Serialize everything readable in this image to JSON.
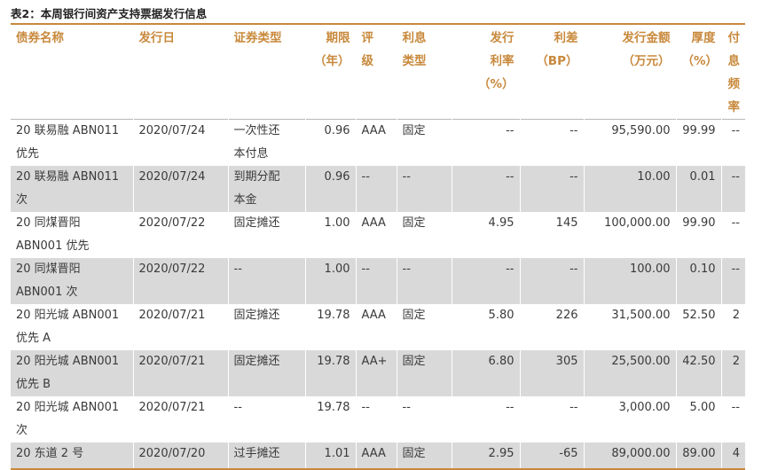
{
  "table_title": "表2：本周银行间资产支持票据发行信息",
  "columns": [
    {
      "line1": "债券名称",
      "line2": "",
      "line3": ""
    },
    {
      "line1": "发行日",
      "line2": "",
      "line3": ""
    },
    {
      "line1": "证券类型",
      "line2": "",
      "line3": ""
    },
    {
      "line1": "期限",
      "line2": "（年）",
      "line3": ""
    },
    {
      "line1": "评",
      "line2": "级",
      "line3": ""
    },
    {
      "line1": "利息",
      "line2": "类型",
      "line3": ""
    },
    {
      "line1": "发行",
      "line2": "利率",
      "line3": "（%）"
    },
    {
      "line1": "利差",
      "line2": "（BP）",
      "line3": ""
    },
    {
      "line1": "发行金额",
      "line2": "（万元）",
      "line3": ""
    },
    {
      "line1": "厚度",
      "line2": "（%）",
      "line3": ""
    },
    {
      "line1": "付息",
      "line2": "频率",
      "line3": ""
    }
  ],
  "rows": [
    {
      "name1": "20 联易融 ABN011",
      "name2": "优先",
      "date": "2020/07/24",
      "type1": "一次性还",
      "type2": "本付息",
      "term": "0.96",
      "rating": "AAA",
      "interest": "固定",
      "rate": "--",
      "spread": "--",
      "amount": "95,590.00",
      "thickness": "99.99",
      "freq": "--"
    },
    {
      "name1": "20 联易融 ABN011",
      "name2": "次",
      "date": "2020/07/24",
      "type1": "到期分配",
      "type2": "本金",
      "term": "0.96",
      "rating": "--",
      "interest": "--",
      "rate": "--",
      "spread": "--",
      "amount": "10.00",
      "thickness": "0.01",
      "freq": "--"
    },
    {
      "name1": "20 同煤晋阳",
      "name2": "ABN001 优先",
      "date": "2020/07/22",
      "type1": "固定摊还",
      "type2": "",
      "term": "1.00",
      "rating": "AAA",
      "interest": "固定",
      "rate": "4.95",
      "spread": "145",
      "amount": "100,000.00",
      "thickness": "99.90",
      "freq": "--"
    },
    {
      "name1": "20 同煤晋阳",
      "name2": "ABN001 次",
      "date": "2020/07/22",
      "type1": "--",
      "type2": "",
      "term": "1.00",
      "rating": "--",
      "interest": "--",
      "rate": "--",
      "spread": "--",
      "amount": "100.00",
      "thickness": "0.10",
      "freq": "--"
    },
    {
      "name1": "20 阳光城 ABN001",
      "name2": "优先 A",
      "date": "2020/07/21",
      "type1": "固定摊还",
      "type2": "",
      "term": "19.78",
      "rating": "AAA",
      "interest": "固定",
      "rate": "5.80",
      "spread": "226",
      "amount": "31,500.00",
      "thickness": "52.50",
      "freq": "2"
    },
    {
      "name1": "20 阳光城 ABN001",
      "name2": "优先 B",
      "date": "2020/07/21",
      "type1": "固定摊还",
      "type2": "",
      "term": "19.78",
      "rating": "AA+",
      "interest": "固定",
      "rate": "6.80",
      "spread": "305",
      "amount": "25,500.00",
      "thickness": "42.50",
      "freq": "2"
    },
    {
      "name1": "20 阳光城 ABN001",
      "name2": "次",
      "date": "2020/07/21",
      "type1": "--",
      "type2": "",
      "term": "19.78",
      "rating": "--",
      "interest": "--",
      "rate": "--",
      "spread": "--",
      "amount": "3,000.00",
      "thickness": "5.00",
      "freq": "--"
    },
    {
      "name1": "20 东道 2 号",
      "name2": "",
      "date": "2020/07/20",
      "type1": "过手摊还",
      "type2": "",
      "term": "1.01",
      "rating": "AAA",
      "interest": "固定",
      "rate": "2.95",
      "spread": "-65",
      "amount": "89,000.00",
      "thickness": "89.00",
      "freq": "4"
    }
  ]
}
